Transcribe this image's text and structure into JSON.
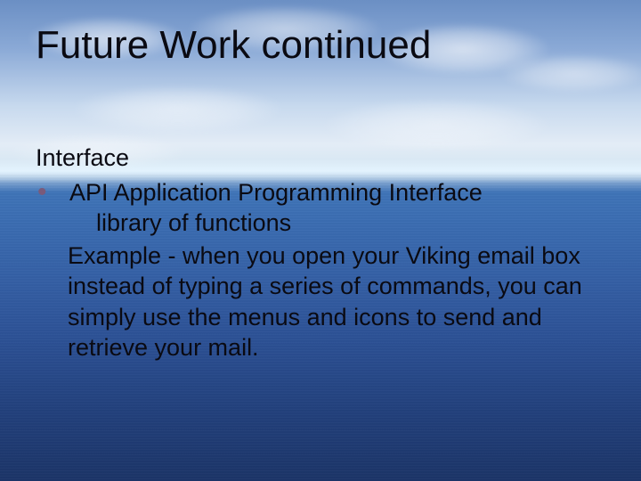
{
  "slide": {
    "title": "Future Work continued",
    "subheading": "Interface",
    "bullet1": "API Application Programming Interface",
    "bullet1_sub": "library of functions",
    "example": "Example - when you open your Viking email box instead of typing a series of commands, you can simply use the menus and icons to send and retrieve your mail."
  }
}
